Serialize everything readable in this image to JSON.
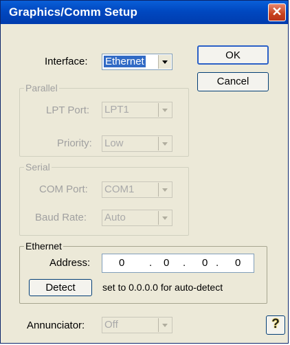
{
  "window": {
    "title": "Graphics/Comm Setup",
    "close_glyph": "✕"
  },
  "interface": {
    "label": "Interface:",
    "value": "Ethernet"
  },
  "buttons": {
    "ok": "OK",
    "cancel": "Cancel",
    "detect": "Detect"
  },
  "parallel": {
    "group_label": "Parallel",
    "lpt_label": "LPT Port:",
    "lpt_value": "LPT1",
    "priority_label": "Priority:",
    "priority_value": "Low"
  },
  "serial": {
    "group_label": "Serial",
    "com_label": "COM Port:",
    "com_value": "COM1",
    "baud_label": "Baud Rate:",
    "baud_value": "Auto"
  },
  "ethernet": {
    "group_label": "Ethernet",
    "address_label": "Address:",
    "address": [
      "0",
      "0",
      "0",
      "0"
    ],
    "dot": ".",
    "hint": "set to 0.0.0.0 for auto-detect"
  },
  "annunciator": {
    "label": "Annunciator:",
    "value": "Off"
  },
  "help": {
    "glyph": "?",
    "icon": "help-icon"
  }
}
